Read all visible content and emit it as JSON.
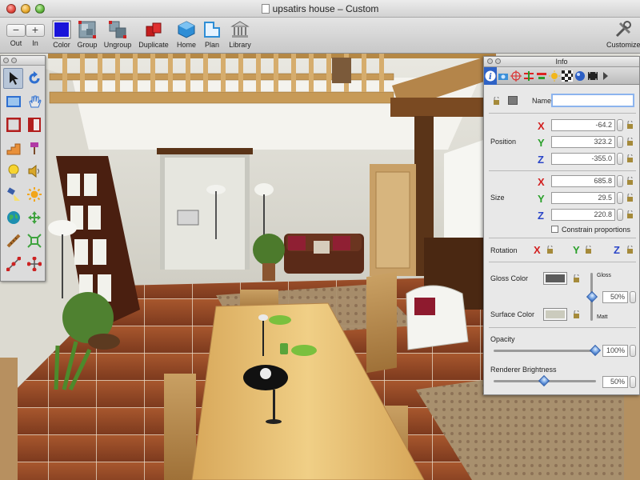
{
  "window": {
    "title": "upsatirs house – Custom"
  },
  "toolbar": {
    "zoom_out_label": "Out",
    "zoom_in_label": "In",
    "color_label": "Color",
    "group_label": "Group",
    "ungroup_label": "Ungroup",
    "duplicate_label": "Duplicate",
    "home_label": "Home",
    "plan_label": "Plan",
    "library_label": "Library",
    "customize_label": "Customize"
  },
  "palette": {
    "tools": [
      "arrow-select-icon",
      "rotate-icon",
      "rectangle-icon",
      "hand-pan-icon",
      "wall-icon",
      "door-icon",
      "stairs-icon",
      "paint-icon",
      "light-bulb-icon",
      "speaker-icon",
      "spotlight-icon",
      "sun-icon",
      "globe-icon",
      "move-icon",
      "measure-icon",
      "resize-icon",
      "path-icon",
      "node-icon"
    ]
  },
  "info": {
    "title": "Info",
    "tabs": [
      "info-icon",
      "camera-icon",
      "target-icon",
      "transform-icon",
      "align-icon",
      "light-icon",
      "texture-icon",
      "material-icon",
      "film-icon",
      "options-icon"
    ],
    "name_label": "Name",
    "name_value": "",
    "position": {
      "label": "Position",
      "x": "-64.2",
      "y": "323.2",
      "z": "-355.0"
    },
    "size": {
      "label": "Size",
      "x": "685.8",
      "y": "29.5",
      "z": "220.8"
    },
    "constrain_label": "Constrain proportions",
    "rotation": {
      "label": "Rotation"
    },
    "axis_labels": {
      "x": "X",
      "y": "Y",
      "z": "Z"
    },
    "gloss_color": {
      "label": "Gloss Color",
      "color": "#5c5c5c"
    },
    "surface_color": {
      "label": "Surface Color",
      "color": "#cbcbbd"
    },
    "gloss_slider": {
      "top_label": "Gloss",
      "bottom_label": "Matt",
      "value": "50%",
      "level": 0.5
    },
    "opacity": {
      "label": "Opacity",
      "value": "100%",
      "level": 1.0
    },
    "renderer_brightness": {
      "label": "Renderer Brightness",
      "value": "50%",
      "level": 0.5
    }
  }
}
